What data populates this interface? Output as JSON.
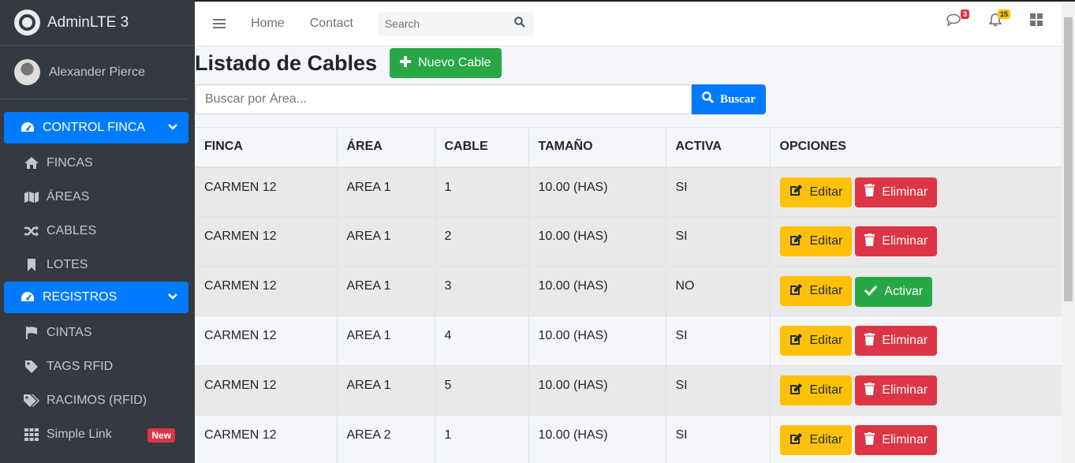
{
  "brand": {
    "name": "AdminLTE 3"
  },
  "user": {
    "name": "Alexander Pierce"
  },
  "sidebar": {
    "items": [
      {
        "label": "CONTROL FINCA",
        "icon": "tachometer-icon",
        "active": true,
        "expandable": true
      },
      {
        "label": "FINCAS",
        "icon": "home-icon"
      },
      {
        "label": "ÁREAS",
        "icon": "map-icon"
      },
      {
        "label": "CABLES",
        "icon": "random-icon"
      },
      {
        "label": "LOTES",
        "icon": "bookmark-icon"
      },
      {
        "label": "REGISTROS",
        "icon": "tachometer-icon",
        "active": true,
        "expandable": true
      },
      {
        "label": "CINTAS",
        "icon": "flag-icon"
      },
      {
        "label": "TAGS RFID",
        "icon": "tag-icon"
      },
      {
        "label": "RACIMOS (RFID)",
        "icon": "tags-icon"
      },
      {
        "label": "Simple Link",
        "icon": "grid-icon",
        "badge": "New"
      }
    ]
  },
  "navbar": {
    "links": [
      "Home",
      "Contact"
    ],
    "search_placeholder": "Search",
    "messages_count": "3",
    "notifications_count": "15"
  },
  "page": {
    "title": "Listado de Cables",
    "new_button": "Nuevo Cable",
    "search_placeholder": "Buscar por Área...",
    "search_button": "Buscar"
  },
  "table": {
    "headers": [
      "FINCA",
      "ÁREA",
      "CABLE",
      "TAMAÑO",
      "ACTIVA",
      "OPCIONES"
    ],
    "edit_label": "Editar",
    "rows": [
      {
        "finca": "CARMEN 12",
        "area": "AREA 1",
        "cable": "1",
        "tamano": "10.00 (HAS)",
        "activa": "SI",
        "action": "Eliminar"
      },
      {
        "finca": "CARMEN 12",
        "area": "AREA 1",
        "cable": "2",
        "tamano": "10.00 (HAS)",
        "activa": "SI",
        "action": "Eliminar"
      },
      {
        "finca": "CARMEN 12",
        "area": "AREA 1",
        "cable": "3",
        "tamano": "10.00 (HAS)",
        "activa": "NO",
        "action": "Activar"
      },
      {
        "finca": "CARMEN 12",
        "area": "AREA 1",
        "cable": "4",
        "tamano": "10.00 (HAS)",
        "activa": "SI",
        "action": "Eliminar"
      },
      {
        "finca": "CARMEN 12",
        "area": "AREA 1",
        "cable": "5",
        "tamano": "10.00 (HAS)",
        "activa": "SI",
        "action": "Eliminar"
      },
      {
        "finca": "CARMEN 12",
        "area": "AREA 2",
        "cable": "1",
        "tamano": "10.00 (HAS)",
        "activa": "SI",
        "action": "Eliminar"
      }
    ]
  },
  "colors": {
    "primary": "#007bff",
    "success": "#28a745",
    "warning": "#ffc107",
    "danger": "#dc3545",
    "sidebar": "#343a40"
  }
}
